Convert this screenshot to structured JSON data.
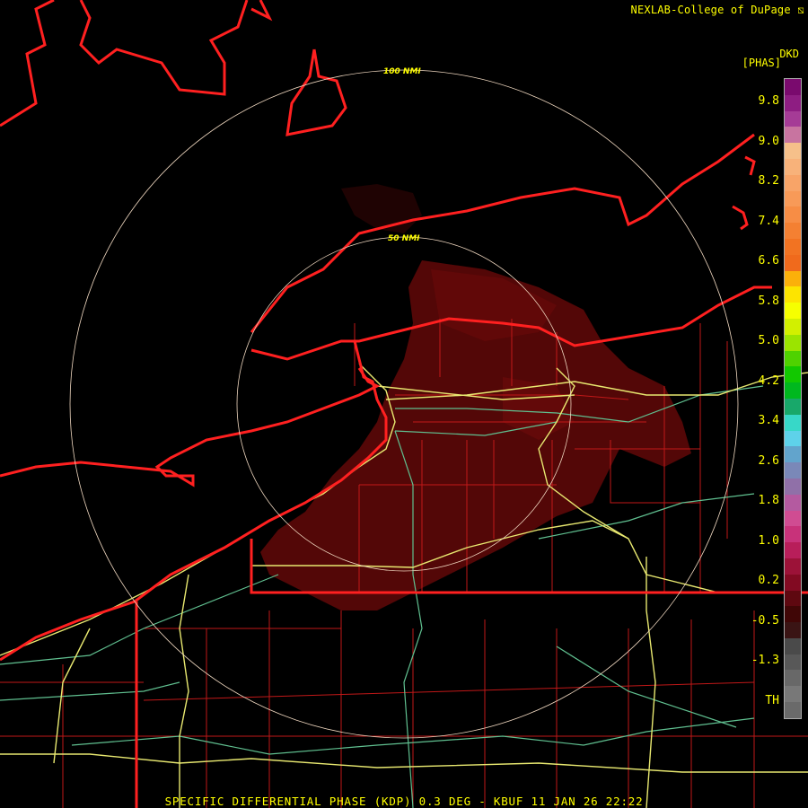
{
  "header": {
    "credit": "NEXLAB-College of DuPage ⧅"
  },
  "legend": {
    "unit_line1": "DKD",
    "unit_line2": "[PHAS]",
    "ticks": [
      "9.8",
      "9.0",
      "8.2",
      "7.4",
      "6.6",
      "5.8",
      "5.0",
      "4.2",
      "3.4",
      "2.6",
      "1.8",
      "1.0",
      "0.2",
      "-0.5",
      "-1.3",
      "TH"
    ],
    "colors": [
      "#7a0a6e",
      "#8e1d82",
      "#a53b96",
      "#c874a0",
      "#f6c08a",
      "#f8b27a",
      "#f8a468",
      "#f89a58",
      "#f78d45",
      "#f48032",
      "#f27322",
      "#f06a1c",
      "#fbb00a",
      "#fde400",
      "#f6ff00",
      "#d2f000",
      "#9be400",
      "#4fd200",
      "#12c800",
      "#00b81e",
      "#18a86a",
      "#37d8c8",
      "#5ed2ea",
      "#62a4cc",
      "#7a88b8",
      "#9070a8",
      "#b45aa0",
      "#d04c92",
      "#c8327a",
      "#b81e5a",
      "#9c1238",
      "#820a22",
      "#5e0810",
      "#400606",
      "#3a1414",
      "#4a4a4a",
      "#585858",
      "#686868",
      "#787878",
      "#6a6a6a"
    ],
    "accent": "#ffff00"
  },
  "map": {
    "range_rings": [
      "100 NMI",
      "50 NMI"
    ],
    "colors": {
      "state_lines": "#ff2020",
      "county_lines": "#c01818",
      "highways": "#e8e870",
      "roads": "#60c090",
      "echo": "#5a0808",
      "ring": "#f0d8c0"
    }
  },
  "footer": {
    "product": "SPECIFIC DIFFERENTIAL PHASE (KDP) 0.3 DEG - KBUF 11 JAN 26 22:22"
  }
}
